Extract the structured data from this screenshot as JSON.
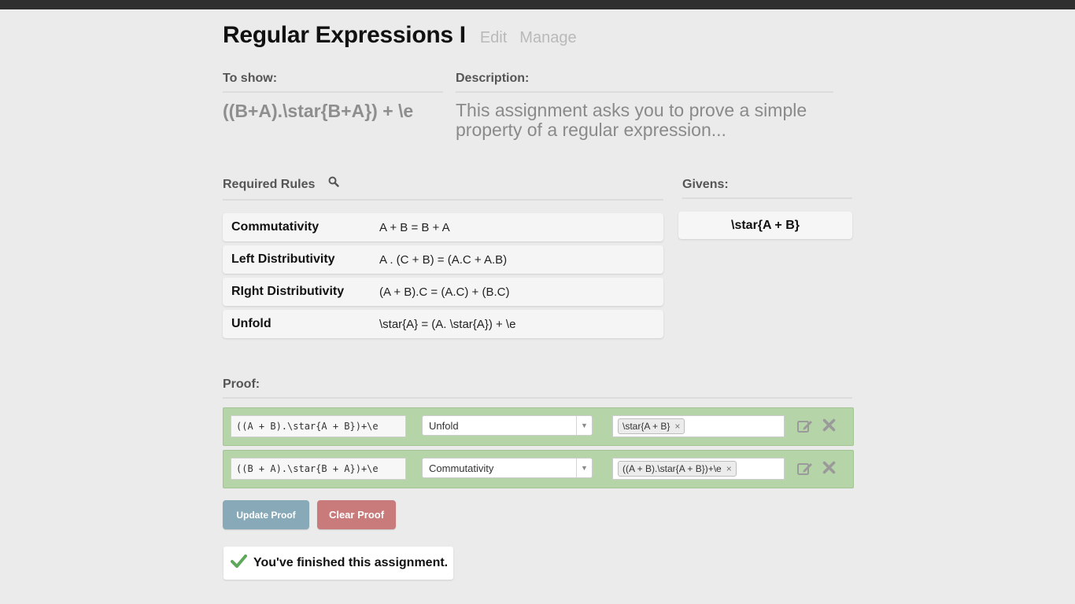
{
  "assignment": {
    "title": "Regular Expressions I",
    "edit_link": "Edit",
    "manage_link": "Manage"
  },
  "to_show": {
    "label": "To show:",
    "value": "((B+A).\\star{B+A}) + \\e"
  },
  "description": {
    "label": "Description:",
    "text": "This assignment asks you to prove a simple property of a regular expression..."
  },
  "required_rules": {
    "label": "Required Rules",
    "items": [
      {
        "name": "Commutativity",
        "formula": "A + B = B + A"
      },
      {
        "name": "Left Distributivity",
        "formula": "A . (C + B) = (A.C + A.B)"
      },
      {
        "name": "RIght Distributivity",
        "formula": "(A + B).C = (A.C) + (B.C)"
      },
      {
        "name": "Unfold",
        "formula": "\\star{A} = (A. \\star{A}) + \\e"
      }
    ]
  },
  "givens": {
    "label": "Givens:",
    "items": [
      "\\star{A + B}"
    ]
  },
  "proof": {
    "label": "Proof:",
    "steps": [
      {
        "expression": "((A + B).\\star{A + B})+\\e",
        "rule": "Unfold",
        "premise": "\\star{A + B}"
      },
      {
        "expression": "((B + A).\\star{B + A})+\\e",
        "rule": "Commutativity",
        "premise": "((A + B).\\star{A + B})+\\e"
      }
    ],
    "step_color": "#b5d4a8",
    "update_button": "Update Proof",
    "clear_button": "Clear Proof"
  },
  "status": {
    "message": "You've finished this assignment.",
    "icon": "checkmark-icon",
    "color": "#5ea85a"
  },
  "icons": {
    "search": "search-icon",
    "edit": "edit-icon",
    "delete": "delete-icon",
    "dropdown": "chevron-down-icon",
    "remove_tag": "close-icon"
  }
}
